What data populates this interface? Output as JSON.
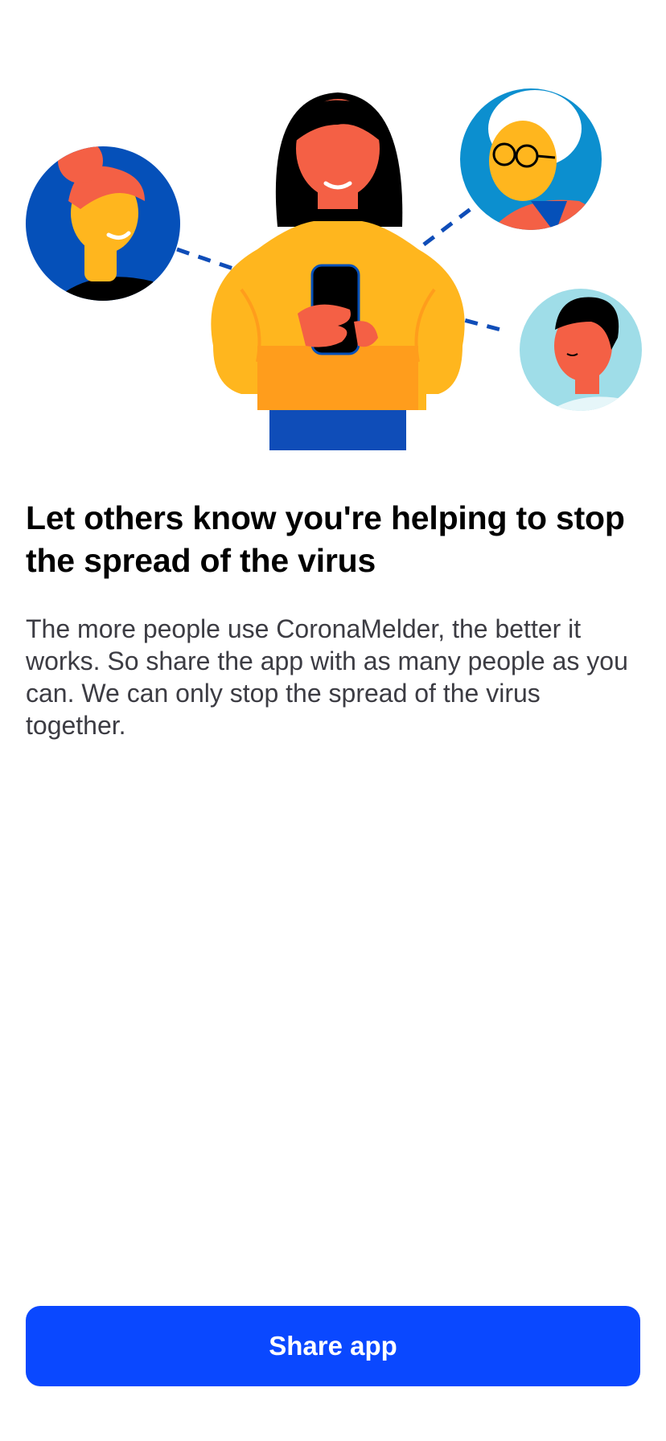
{
  "onboarding": {
    "title": "Let others know you're helping to stop the spread of the virus",
    "body": "The more people use CoronaMelder, the better it works. So share the app with as many people as you can. We can only stop the spread of the virus together.",
    "share_button_label": "Share app"
  },
  "illustration": {
    "icon": "people-sharing-illustration",
    "colors": {
      "primary_blue": "#0a48ff",
      "dark_blue": "#0f4db8",
      "avatar_blue": "#0550b9",
      "light_blue": "#0c8fcf",
      "cyan": "#9fdde8",
      "yellow": "#ffb61e",
      "orange": "#ff9d1c",
      "skin": "#f46045",
      "hair_dark": "#000000"
    }
  }
}
